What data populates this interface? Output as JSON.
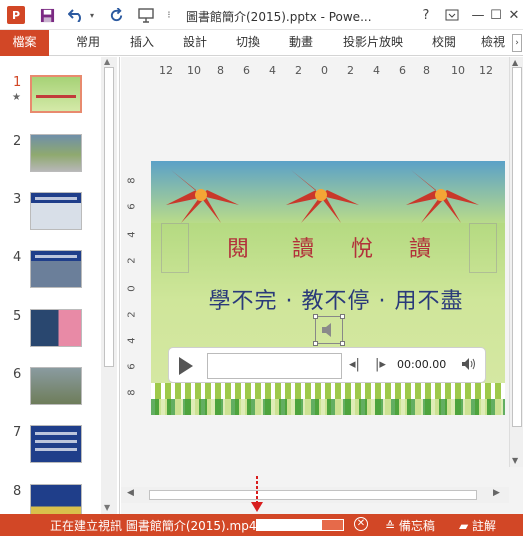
{
  "window": {
    "app_icon": "P",
    "title": "圖書館簡介(2015).pptx - Powe...",
    "quick_access": [
      "save-icon",
      "undo-icon",
      "redo-icon",
      "present-icon",
      "more-icon"
    ],
    "help": "?",
    "minimize": "—",
    "restore": "☐",
    "close": "✕"
  },
  "ribbon": {
    "tabs": [
      "檔案",
      "常用",
      "插入",
      "設計",
      "切換",
      "動畫",
      "投影片放映",
      "校閱",
      "檢視"
    ],
    "scroll": "›"
  },
  "slide_panel": {
    "slides": [
      {
        "num": "1",
        "star": "★",
        "active": true
      },
      {
        "num": "2",
        "active": false
      },
      {
        "num": "3",
        "active": false
      },
      {
        "num": "4",
        "active": false
      },
      {
        "num": "5",
        "active": false
      },
      {
        "num": "6",
        "active": false
      },
      {
        "num": "7",
        "active": false
      },
      {
        "num": "8",
        "active": false
      }
    ]
  },
  "ruler": {
    "horizontal": [
      "12",
      "10",
      "8",
      "6",
      "4",
      "2",
      "0",
      "2",
      "4",
      "6",
      "8",
      "10",
      "12"
    ],
    "vertical": [
      "8",
      "6",
      "4",
      "2",
      "0",
      "2",
      "4",
      "6",
      "8"
    ]
  },
  "slide": {
    "title_chars": [
      "閱",
      "讀",
      "悅",
      "讀"
    ],
    "subtitle": "學不完 · 教不停 · 用不盡",
    "media_time": "00:00.00"
  },
  "status": {
    "export_text": "正在建立視訊 圖書館簡介(2015).mp4",
    "progress_fraction": 0.75,
    "cancel": "✕",
    "notes": "備忘稿",
    "comments": "註解"
  },
  "colors": {
    "accent": "#d24726",
    "annotation_arrow": "#d81e1e"
  }
}
